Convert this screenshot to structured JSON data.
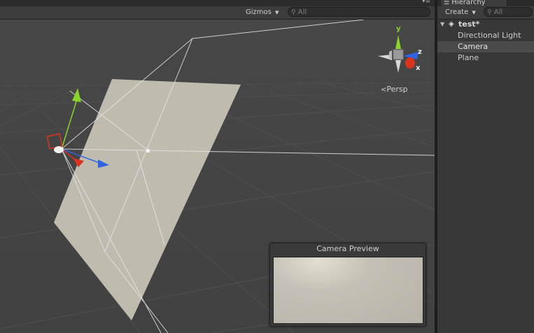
{
  "scene_toolbar": {
    "gizmos_label": "Gizmos",
    "search_placeholder": "All"
  },
  "scene": {
    "projection_label": "Persp",
    "gizmo_axes": {
      "x": "x",
      "y": "y",
      "z": "z"
    }
  },
  "camera_preview": {
    "title": "Camera Preview"
  },
  "hierarchy": {
    "tab_label": "Hierarchy",
    "create_label": "Create",
    "search_placeholder": "All",
    "scene_name": "test*",
    "items": [
      {
        "label": "Directional Light",
        "selected": false
      },
      {
        "label": "Camera",
        "selected": true
      },
      {
        "label": "Plane",
        "selected": false
      }
    ]
  },
  "colors": {
    "x_axis": "#d9331e",
    "y_axis": "#8bd42e",
    "z_axis": "#2f63e0",
    "plane": "#bfbbaf",
    "selection": "#4a4a4a"
  }
}
